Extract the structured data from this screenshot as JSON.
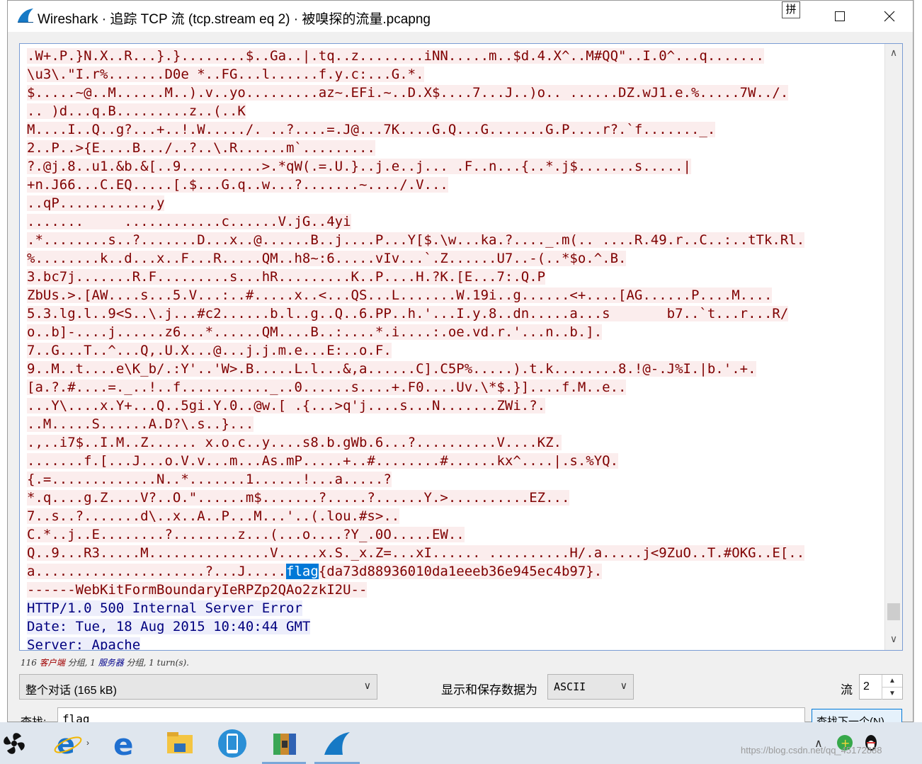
{
  "window": {
    "title": "Wireshark · 追踪 TCP 流 (tcp.stream eq 2) · 被嗅探的流量.pcapng"
  },
  "stream": {
    "client_lines": [
      ".W+.P.}N.X..R...}.}........$..Ga..|.tq..z........iNN.....m..$d.4.X^..M#QQ\"..I.0^...q.......",
      "\\u3\\.\"I.r%.......D0e *..FG...l......f.y.c:...G.*.",
      "$.....~@..M......M..).v..yo.........az~.EFi.~..D.X$....7...J..)o.. ......DZ.wJ1.e.%.....7W../.",
      ".. )d...q.B.........z..(..K",
      "M....I..Q..g?...+..!.W...../. ..?....=.J@...7K....G.Q...G.......G.P....r?.`f......._.",
      "2..P..>{E....B.../..?..\\.R......m`.........",
      "?.@j.8..u1.&b.&[..9..........>.*qW(.=.U.}..j.e..j... .F..n...{..*.j$.......s.....|",
      "+n.J66...C.EQ.....[.$...G.q..w...?.......~..../.V...",
      "..qP...........,y",
      ".......     ............c......V.jG..4yi",
      ".*........s..?.......D...x..@......B..j....P...Y[$.\\w...ka.?...._.m(.. ....R.49.r..C..:..tTk.Rl.",
      "%........k..d...x..F...R.....QM..h8~:6.....vIv...`.Z......U7..-(..*$o.^.B.",
      "3.bc7j.......R.F.........s...hR.........K..P....H.?K.[E...7:.Q.P",
      "ZbUs.>.[AW....s...5.V...:..#.....x..<...QS...L.......W.19i..g......<+....[AG......P....M....",
      "5.3.lg.l..9<S..\\.j...#c2......b.l..g..Q..6.PP..h.'...I.y.8..dn.....a...s       b7..`t...r...R/",
      "o..b]-....j......z6...*......QM....B..:....*.i....:.oe.vd.r.'...n..b.].",
      "7..G...T..^...Q,.U.X...@...j.j.m.e...E:..o.F.",
      "9..M..t....e\\K_b/.:Y'..'W>.B.....L.l...&,a......C].C5P%.....).t.k........8.!@-.J%I.|b.'.+.",
      "[a.?.#....=._..!..f..........._..0......s....+.F0....Uv.\\*$.}]....f.M..e..",
      "...Y\\....x.Y+...Q..5gi.Y.0..@w.[ .{...>q'j....s...N.......ZWi.?.",
      "..M.....S......A.D?\\.s..}...",
      ".,..i7$..I.M..Z...... x.o.c..y....s8.b.gWb.6...?..........V....KZ.",
      ".......f.[...J...o.V.v...m...As.mP.....+..#........#......kx^....|.s.%YQ.",
      "{.=.............N..*.......1......!...a.....?",
      "*.q....g.Z....V?..O.\"......m$.......?.....?......Y.>..........EZ...",
      "7..s..?.......d\\..x..A..P...M...'..(.lou.#s>..",
      "C.*..j..E........?........z...(...o....?Y_.0O.....EW..",
      "Q..9...R3.....M...............V.....x.S._x.Z=...xI...... ..........H/.a.....j<9ZuO..T.#OKG..E[.."
    ],
    "flag_line_prefix": "a.....................?...J.....",
    "flag_keyword": "flag",
    "flag_line_suffix": "{da73d88936010da1eeeb36e945ec4b97}.",
    "boundary_line": "------WebKitFormBoundaryIeRPZp2QAo2zkI2U--",
    "server_lines": [
      "HTTP/1.0 500 Internal Server Error",
      "Date: Tue, 18 Aug 2015 10:40:44 GMT",
      "Server: Apache"
    ]
  },
  "status": {
    "client_count": "116",
    "client_label": "客户端",
    "mid1": "分组,",
    "server_count": "1",
    "server_label": "服务器",
    "mid2": "分组, 1 turn(s)."
  },
  "controls": {
    "conversation_value": "整个对话 (165 kB)",
    "show_label": "显示和保存数据为",
    "encoding_value": "ASCII",
    "stream_label": "流",
    "stream_value": "2",
    "find_label": "查找:",
    "find_value": "flag",
    "find_next_button": "查找下一个(N)"
  },
  "taskbar": {
    "ime_label": "拼",
    "watermark": "https://blog.csdn.net/qq_45172888"
  },
  "colors": {
    "client_bg": "#fbeded",
    "client_fg": "#7f0000",
    "server_bg": "#edeefb",
    "server_fg": "#00007f",
    "selection": "#0078d7"
  }
}
